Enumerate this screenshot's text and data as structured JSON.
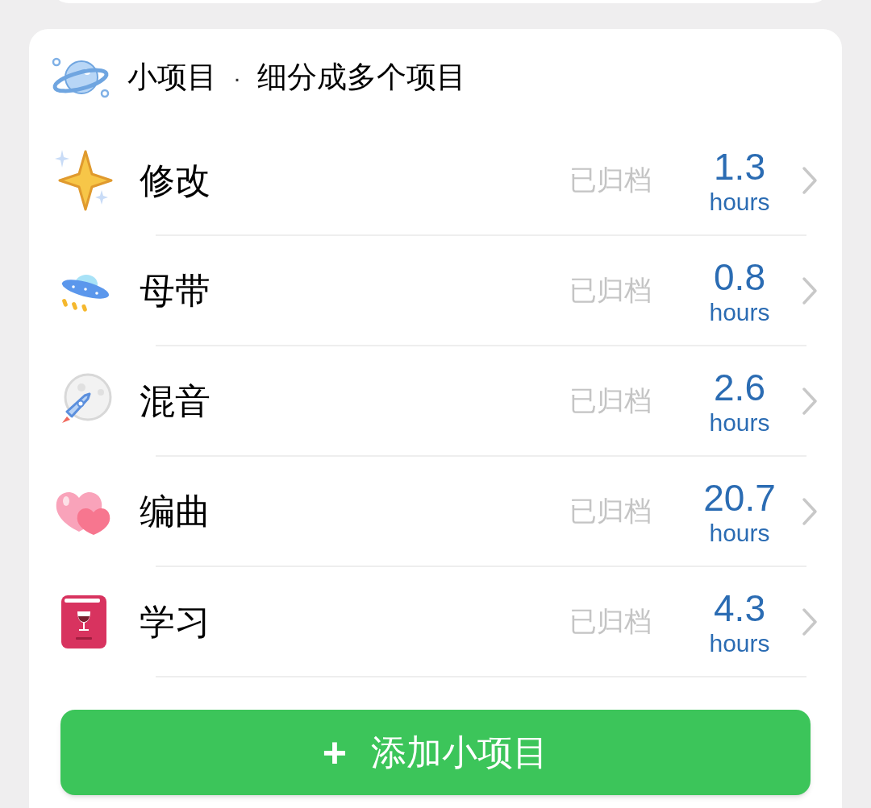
{
  "card": {
    "title": "小项目",
    "separator": "·",
    "subtitle": "细分成多个项目"
  },
  "items": [
    {
      "name": "修改",
      "status": "已归档",
      "value": "1.3",
      "unit": "hours"
    },
    {
      "name": "母带",
      "status": "已归档",
      "value": "0.8",
      "unit": "hours"
    },
    {
      "name": "混音",
      "status": "已归档",
      "value": "2.6",
      "unit": "hours"
    },
    {
      "name": "编曲",
      "status": "已归档",
      "value": "20.7",
      "unit": "hours"
    },
    {
      "name": "学习",
      "status": "已归档",
      "value": "4.3",
      "unit": "hours"
    }
  ],
  "add_button": {
    "icon": "+",
    "label": "添加小项目"
  }
}
